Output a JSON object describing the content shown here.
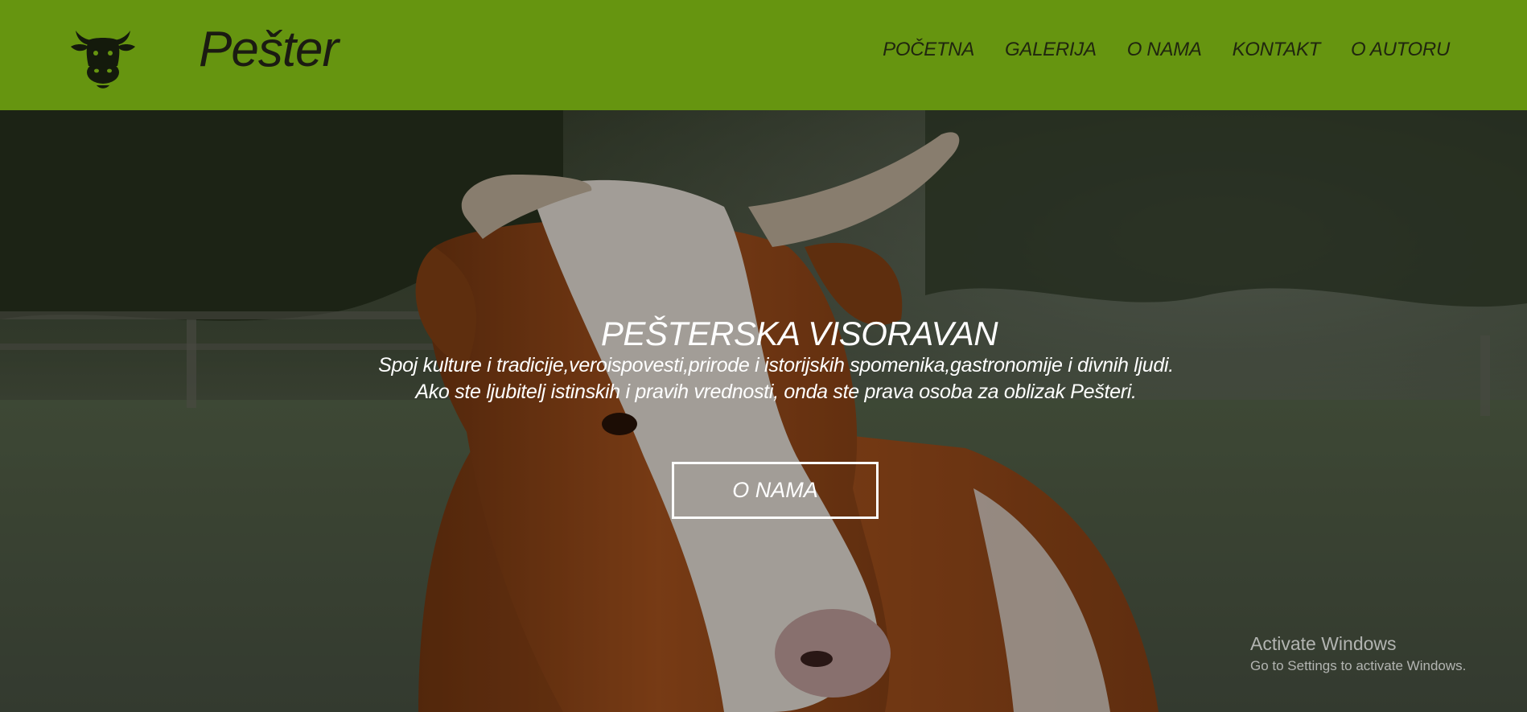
{
  "header": {
    "brand": "Pešter",
    "logo_icon": "cow-head-icon",
    "background_color": "#669510",
    "nav": [
      {
        "label": "POČETNA"
      },
      {
        "label": "GALERIJA"
      },
      {
        "label": "O NAMA"
      },
      {
        "label": "KONTAKT"
      },
      {
        "label": "O AUTORU"
      }
    ]
  },
  "hero": {
    "background_image": "cow-lying-in-meadow",
    "title": "PEŠTERSKA VISORAVAN",
    "subtitle_line1": "Spoj kulture i tradicije,veroispovesti,prirode i istorijskih spomenika,gastronomije i divnih ljudi.",
    "subtitle_line2": "Ako ste ljubitelj istinskih i pravih vrednosti, onda ste prava osoba za oblizak Pešteri.",
    "button_label": "O NAMA"
  },
  "os_watermark": {
    "title": "Activate Windows",
    "subtitle": "Go to Settings to activate Windows."
  }
}
